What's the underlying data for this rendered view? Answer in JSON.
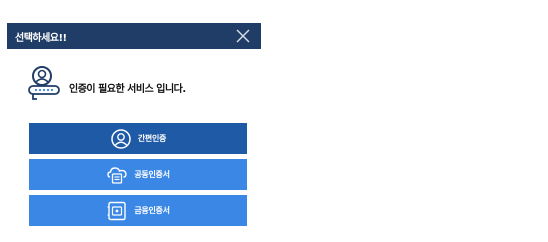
{
  "dialog": {
    "title": "선택하세요!!",
    "notice": "인증이 필요한 서비스 입니다."
  },
  "buttons": [
    {
      "label": "간편인증",
      "icon": "person-circle-icon"
    },
    {
      "label": "공동인증서",
      "icon": "cloud-certificate-icon"
    },
    {
      "label": "금융인증서",
      "icon": "finance-certificate-icon"
    }
  ],
  "colors": {
    "titlebar": "#1f3d67",
    "button_primary": "#1f5aa6",
    "button_secondary": "#3a87e6",
    "text": "#111111"
  }
}
